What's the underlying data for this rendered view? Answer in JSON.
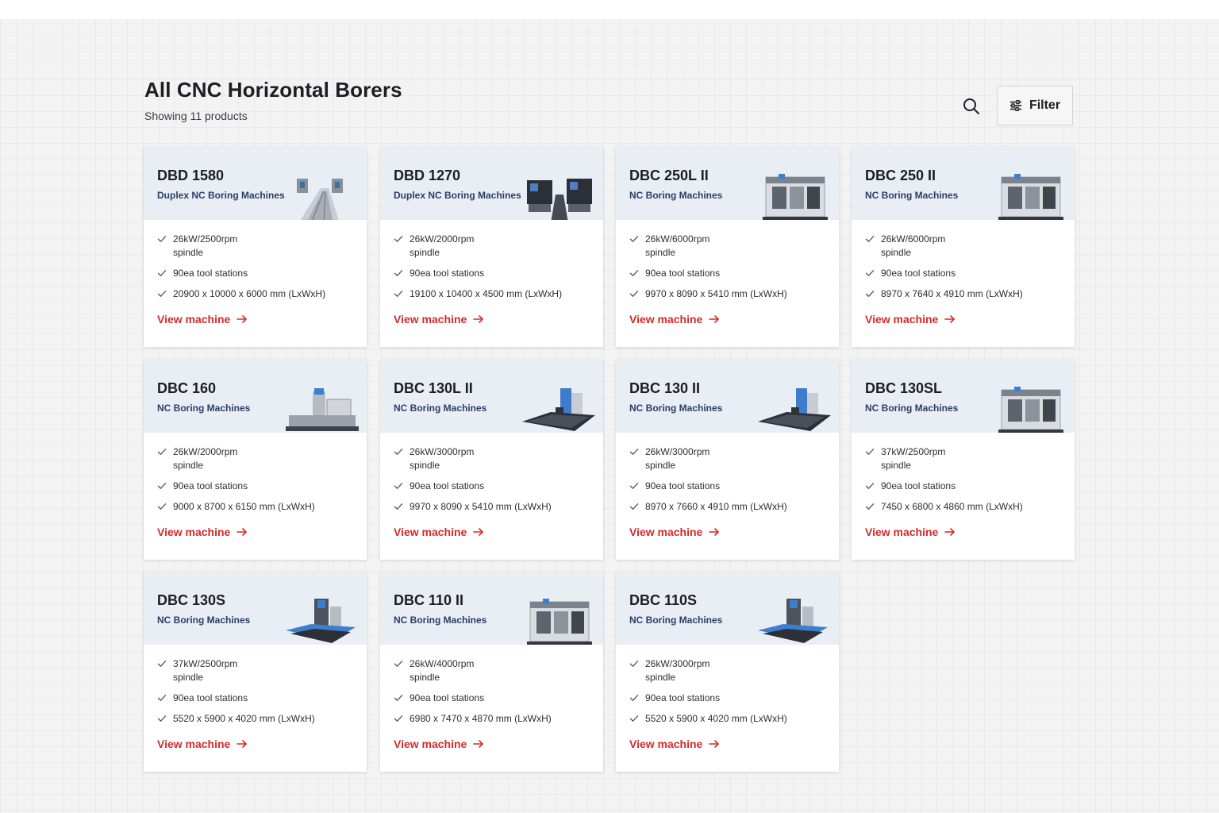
{
  "header": {
    "title": "All CNC Horizontal Borers",
    "subtitle": "Showing 11 products",
    "filter_label": "Filter"
  },
  "products": [
    {
      "name": "DBD 1580",
      "category": "Duplex NC Boring Machines",
      "spindle": "26kW/2500rpm spindle",
      "tools": "90ea tool stations",
      "dims": "20900 x 10000 x 6000 mm (LxWxH)",
      "link": "View machine",
      "image": "duplex-table"
    },
    {
      "name": "DBD 1270",
      "category": "Duplex NC Boring Machines",
      "spindle": "26kW/2000rpm spindle",
      "tools": "90ea tool stations",
      "dims": "19100 x 10400 x 4500 mm (LxWxH)",
      "link": "View machine",
      "image": "duplex-dark"
    },
    {
      "name": "DBC 250L II",
      "category": "NC Boring Machines",
      "spindle": "26kW/6000rpm spindle",
      "tools": "90ea tool stations",
      "dims": "9970 x 8090 x 5410 mm (LxWxH)",
      "link": "View machine",
      "image": "enclosed"
    },
    {
      "name": "DBC 250 II",
      "category": "NC Boring Machines",
      "spindle": "26kW/6000rpm spindle",
      "tools": "90ea tool stations",
      "dims": "8970 x 7640 x 4910 mm (LxWxH)",
      "link": "View machine",
      "image": "enclosed"
    },
    {
      "name": "DBC 160",
      "category": "NC Boring Machines",
      "spindle": "26kW/2000rpm spindle",
      "tools": "90ea tool stations",
      "dims": "9000 x 8700 x 6150 mm (LxWxH)",
      "link": "View machine",
      "image": "open-gray"
    },
    {
      "name": "DBC 130L II",
      "category": "NC Boring Machines",
      "spindle": "26kW/3000rpm spindle",
      "tools": "90ea tool stations",
      "dims": "9970 x 8090 x 5410 mm (LxWxH)",
      "link": "View machine",
      "image": "open-blue"
    },
    {
      "name": "DBC 130 II",
      "category": "NC Boring Machines",
      "spindle": "26kW/3000rpm spindle",
      "tools": "90ea tool stations",
      "dims": "8970 x 7660 x 4910 mm (LxWxH)",
      "link": "View machine",
      "image": "open-blue"
    },
    {
      "name": "DBC 130SL",
      "category": "NC Boring Machines",
      "spindle": "37kW/2500rpm spindle",
      "tools": "90ea tool stations",
      "dims": "7450 x 6800 x 4860 mm (LxWxH)",
      "link": "View machine",
      "image": "enclosed"
    },
    {
      "name": "DBC 130S",
      "category": "NC Boring Machines",
      "spindle": "37kW/2500rpm spindle",
      "tools": "90ea tool stations",
      "dims": "5520 x 5900 x 4020 mm (LxWxH)",
      "link": "View machine",
      "image": "open-table"
    },
    {
      "name": "DBC 110 II",
      "category": "NC Boring Machines",
      "spindle": "26kW/4000rpm spindle",
      "tools": "90ea tool stations",
      "dims": "6980 x 7470 x 4870 mm (LxWxH)",
      "link": "View machine",
      "image": "enclosed"
    },
    {
      "name": "DBC 110S",
      "category": "NC Boring Machines",
      "spindle": "26kW/3000rpm spindle",
      "tools": "90ea tool stations",
      "dims": "5520 x 5900 x 4020 mm (LxWxH)",
      "link": "View machine",
      "image": "open-table"
    }
  ],
  "colors": {
    "accent": "#d42a2a",
    "category_text": "#2a3e66",
    "card_header_bg": "#e9edf4",
    "page_bg": "#f3f3f3"
  },
  "icons": {
    "search": "search-icon",
    "filter": "sliders-icon",
    "check": "check-icon",
    "arrow": "arrow-right-icon"
  }
}
